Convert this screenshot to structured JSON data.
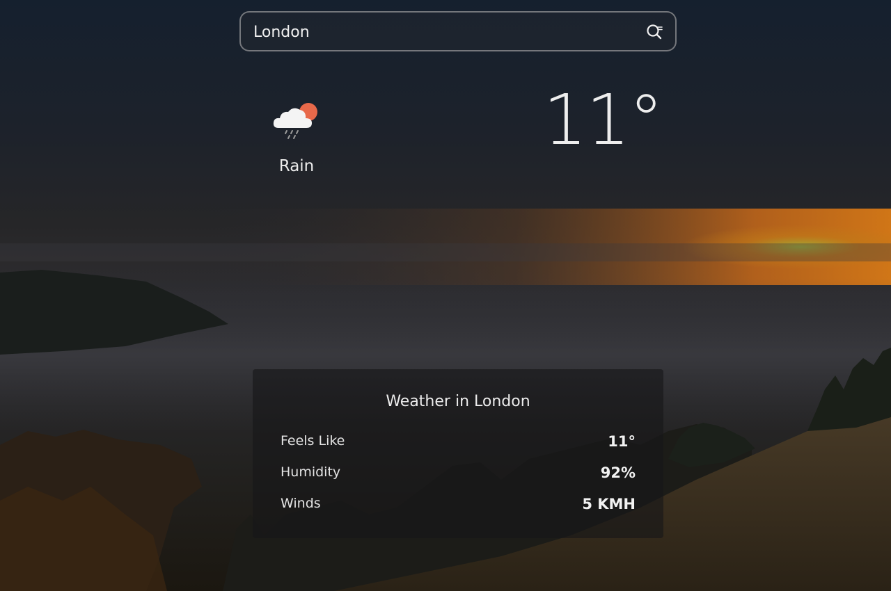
{
  "search": {
    "value": "London",
    "icon": "search-icon"
  },
  "current": {
    "condition": "Rain",
    "icon": "rain-cloud-sun-icon",
    "temperature": "11°"
  },
  "details": {
    "title": "Weather in London",
    "rows": [
      {
        "label": "Feels Like",
        "value": "11°"
      },
      {
        "label": "Humidity",
        "value": "92%"
      },
      {
        "label": "Winds",
        "value": "5 KMH"
      }
    ]
  },
  "colors": {
    "sun": "#e8694a",
    "text": "#ececec"
  }
}
